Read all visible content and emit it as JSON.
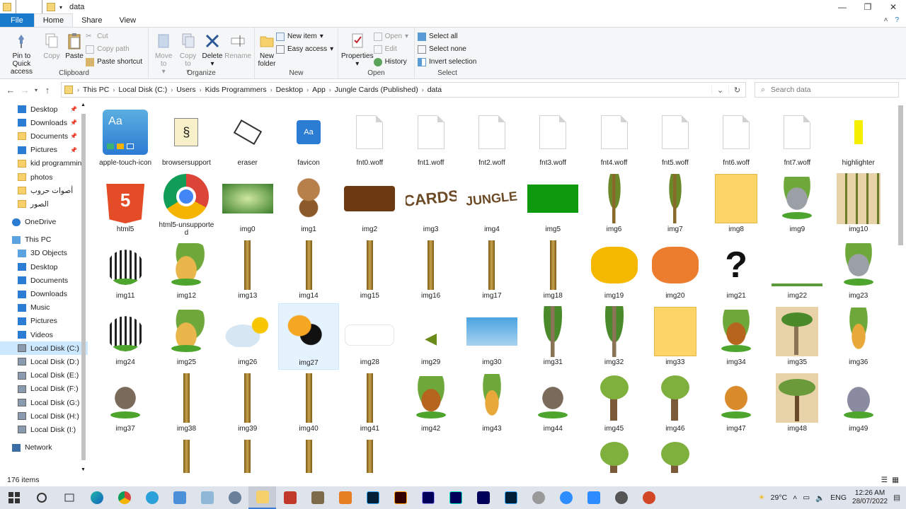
{
  "window": {
    "title": "data"
  },
  "ribbon_tabs": [
    "File",
    "Home",
    "Share",
    "View"
  ],
  "clipboard": {
    "pin": "Pin to Quick access",
    "copy": "Copy",
    "paste": "Paste",
    "cut": "Cut",
    "copy_path": "Copy path",
    "paste_shortcut": "Paste shortcut",
    "label": "Clipboard"
  },
  "organize": {
    "move": "Move to",
    "copy": "Copy to",
    "delete": "Delete",
    "rename": "Rename",
    "label": "Organize"
  },
  "new": {
    "new_folder": "New folder",
    "new_item": "New item",
    "easy_access": "Easy access",
    "label": "New"
  },
  "open": {
    "properties": "Properties",
    "open": "Open",
    "edit": "Edit",
    "history": "History",
    "label": "Open"
  },
  "select": {
    "select_all": "Select all",
    "select_none": "Select none",
    "invert": "Invert selection",
    "label": "Select"
  },
  "breadcrumb": [
    "This PC",
    "Local Disk (C:)",
    "Users",
    "Kids Programmers",
    "Desktop",
    "App",
    "Jungle Cards (Published)",
    "data"
  ],
  "search": {
    "placeholder": "Search data"
  },
  "nav": {
    "quick": [
      "Desktop",
      "Downloads",
      "Documents",
      "Pictures",
      "kid programmin",
      "photos",
      "أصوات حروب",
      "الصور"
    ],
    "onedrive": "OneDrive",
    "thispc": "This PC",
    "pc_items": [
      "3D Objects",
      "Desktop",
      "Documents",
      "Downloads",
      "Music",
      "Pictures",
      "Videos",
      "Local Disk (C:)",
      "Local Disk (D:)",
      "Local Disk (E:)",
      "Local Disk (F:)",
      "Local Disk (G:)",
      "Local Disk (H:)",
      "Local Disk (I:)"
    ],
    "network": "Network"
  },
  "files": [
    {
      "name": "apple-touch-icon",
      "kind": "appleicon"
    },
    {
      "name": "browsersupport",
      "kind": "script"
    },
    {
      "name": "eraser",
      "kind": "eraser"
    },
    {
      "name": "favicon",
      "kind": "favicon"
    },
    {
      "name": "fnt0.woff",
      "kind": "doc"
    },
    {
      "name": "fnt1.woff",
      "kind": "doc"
    },
    {
      "name": "fnt2.woff",
      "kind": "doc"
    },
    {
      "name": "fnt3.woff",
      "kind": "doc"
    },
    {
      "name": "fnt4.woff",
      "kind": "doc"
    },
    {
      "name": "fnt5.woff",
      "kind": "doc"
    },
    {
      "name": "fnt6.woff",
      "kind": "doc"
    },
    {
      "name": "fnt7.woff",
      "kind": "doc"
    },
    {
      "name": "highlighter",
      "kind": "highlighter"
    },
    {
      "name": "html5",
      "kind": "html5"
    },
    {
      "name": "html5-unsupported",
      "kind": "chrome"
    },
    {
      "name": "img0",
      "kind": "jungle"
    },
    {
      "name": "img1",
      "kind": "monkey"
    },
    {
      "name": "img2",
      "kind": "brown"
    },
    {
      "name": "img3",
      "kind": "cards"
    },
    {
      "name": "img4",
      "kind": "junglewd"
    },
    {
      "name": "img5",
      "kind": "green"
    },
    {
      "name": "img6",
      "kind": "tallTree"
    },
    {
      "name": "img7",
      "kind": "tallTree"
    },
    {
      "name": "img8",
      "kind": "yellow"
    },
    {
      "name": "img9",
      "kind": "rhino"
    },
    {
      "name": "img10",
      "kind": "bamboo"
    },
    {
      "name": "img11",
      "kind": "zebra"
    },
    {
      "name": "img12",
      "kind": "cheetah"
    },
    {
      "name": "img13",
      "kind": "pole"
    },
    {
      "name": "img14",
      "kind": "pole"
    },
    {
      "name": "img15",
      "kind": "pole"
    },
    {
      "name": "img16",
      "kind": "pole"
    },
    {
      "name": "img17",
      "kind": "pole"
    },
    {
      "name": "img18",
      "kind": "pole"
    },
    {
      "name": "img19",
      "kind": "cloudY"
    },
    {
      "name": "img20",
      "kind": "cloudO"
    },
    {
      "name": "img21",
      "kind": "question"
    },
    {
      "name": "img22",
      "kind": "grassline"
    },
    {
      "name": "img23",
      "kind": "rhino"
    },
    {
      "name": "img24",
      "kind": "zebra"
    },
    {
      "name": "img25",
      "kind": "cheetah"
    },
    {
      "name": "img26",
      "kind": "weather"
    },
    {
      "name": "img27",
      "kind": "toucan"
    },
    {
      "name": "img28",
      "kind": "bubble"
    },
    {
      "name": "img29",
      "kind": "arrow"
    },
    {
      "name": "img30",
      "kind": "sky"
    },
    {
      "name": "img31",
      "kind": "palm"
    },
    {
      "name": "img32",
      "kind": "palm"
    },
    {
      "name": "img33",
      "kind": "yellow"
    },
    {
      "name": "img34",
      "kind": "monkey2"
    },
    {
      "name": "img35",
      "kind": "palmbg"
    },
    {
      "name": "img36",
      "kind": "giraffe"
    },
    {
      "name": "img37",
      "kind": "wolf"
    },
    {
      "name": "img38",
      "kind": "pole"
    },
    {
      "name": "img39",
      "kind": "pole"
    },
    {
      "name": "img40",
      "kind": "pole"
    },
    {
      "name": "img41",
      "kind": "pole"
    },
    {
      "name": "img42",
      "kind": "monkey2"
    },
    {
      "name": "img43",
      "kind": "giraffe"
    },
    {
      "name": "img44",
      "kind": "wolf"
    },
    {
      "name": "img45",
      "kind": "tree"
    },
    {
      "name": "img46",
      "kind": "tree"
    },
    {
      "name": "img47",
      "kind": "lion"
    },
    {
      "name": "img48",
      "kind": "acacia"
    },
    {
      "name": "img49",
      "kind": "hippo"
    },
    {
      "name": "",
      "kind": "partialAnimal"
    },
    {
      "name": "",
      "kind": "pole"
    },
    {
      "name": "",
      "kind": "pole"
    },
    {
      "name": "",
      "kind": "pole"
    },
    {
      "name": "",
      "kind": "pole"
    },
    {
      "name": "",
      "kind": "partialAnimal"
    },
    {
      "name": "",
      "kind": "partialGrass"
    },
    {
      "name": "",
      "kind": "partialAnimal"
    },
    {
      "name": "",
      "kind": "tree"
    },
    {
      "name": "",
      "kind": "tree"
    },
    {
      "name": "",
      "kind": "partialRock"
    },
    {
      "name": "",
      "kind": "partialAnimal"
    },
    {
      "name": "",
      "kind": "none"
    }
  ],
  "selected_file": "img27",
  "status": {
    "count": "176 items"
  },
  "taskbar": {
    "temp": "29°C",
    "lang": "ENG",
    "time": "12:26 AM",
    "date": "28/07/2022"
  },
  "colors": {
    "accent": "#1979ca",
    "selection": "#cce8ff"
  }
}
